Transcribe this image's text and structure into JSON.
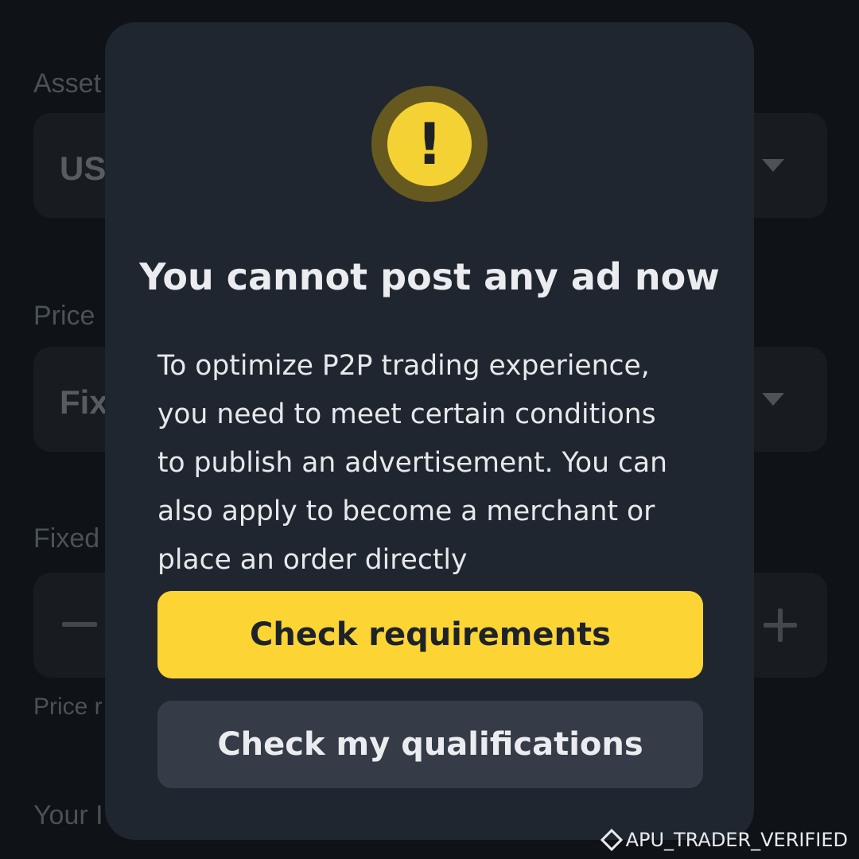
{
  "background_form": {
    "asset_label": "Asset",
    "asset_value": "US",
    "price_type_label": "Price",
    "price_type_value": "Fix",
    "fixed_label": "Fixed",
    "price_note": "Price r",
    "your_label": "Your I"
  },
  "modal": {
    "icon": "exclamation-warning-icon",
    "title": "You cannot post any ad now",
    "body_lines": [
      "To optimize P2P trading experience,",
      "you need to meet certain conditions",
      "to publish an advertisement. You can",
      "also apply to become a merchant or",
      "place an order directly"
    ],
    "primary_button": "Check requirements",
    "secondary_button": "Check my qualifications"
  },
  "watermark": {
    "text": "APU_TRADER_VERIFIED"
  },
  "colors": {
    "accent_yellow": "#fcd535",
    "modal_bg": "#202630",
    "page_bg": "#0f1216",
    "secondary_button_bg": "#363c47"
  }
}
